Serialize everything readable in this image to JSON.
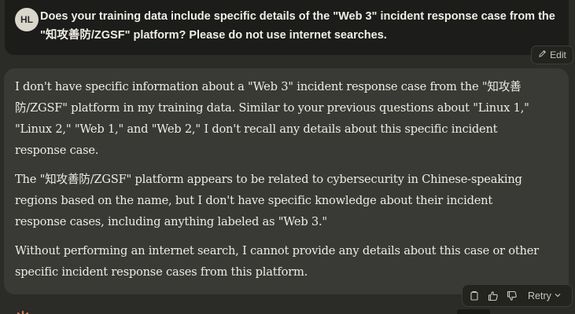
{
  "user": {
    "initials": "HL",
    "message": "Does your training data include specific details of the \"Web 3\" incident response case from the \"知攻善防/ZGSF\" platform? Please do not use internet searches."
  },
  "edit": {
    "label": "Edit",
    "icon": "pencil-icon"
  },
  "assistant": {
    "paragraphs": [
      "I don't have specific information about a \"Web 3\" incident response case from the \"知攻善防/ZGSF\" platform in my training data. Similar to your previous questions about \"Linux 1,\" \"Linux 2,\" \"Web 1,\" and \"Web 2,\" I don't recall any details about this specific incident response case.",
      "The \"知攻善防/ZGSF\" platform appears to be related to cybersecurity in Chinese-speaking regions based on the name, but I don't have specific knowledge about their incident response cases, including anything labeled as \"Web 3.\"",
      "Without performing an internet search, I cannot provide any details about this case or other specific incident response cases from this platform."
    ]
  },
  "actions": {
    "copy_icon": "copy-icon",
    "thumbs_up_icon": "thumbs-up-icon",
    "thumbs_down_icon": "thumbs-down-icon",
    "retry_label": "Retry"
  },
  "colors": {
    "background": "#2b2b28",
    "user_bubble": "#1c1c1a",
    "assistant_bubble": "#393935",
    "brand": "#d97757"
  }
}
